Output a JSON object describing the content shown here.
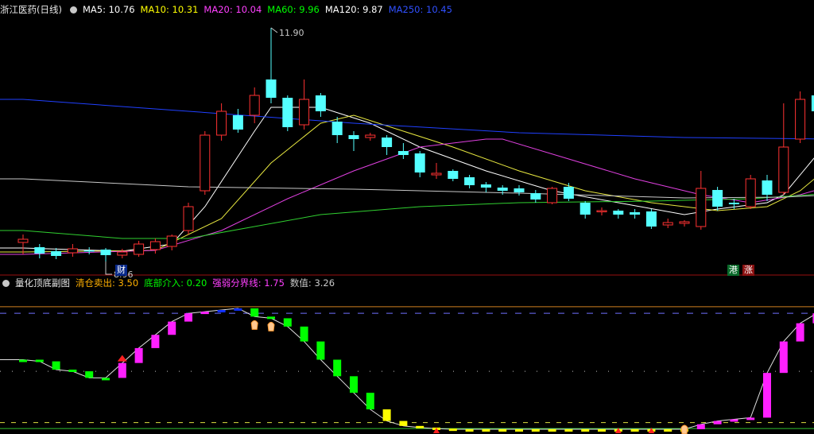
{
  "header": {
    "title": "浙江医药(日线)",
    "ma": [
      {
        "label": "MA5: 10.76",
        "color": "#ffffff"
      },
      {
        "label": "MA10: 10.31",
        "color": "#ffff00"
      },
      {
        "label": "MA20: 10.04",
        "color": "#ff40ff"
      },
      {
        "label": "MA60: 9.96",
        "color": "#00ff00"
      },
      {
        "label": "MA120: 9.87",
        "color": "#ffffff"
      },
      {
        "label": "MA250: 10.45",
        "color": "#3050ff"
      }
    ]
  },
  "sub_header": {
    "title": "量化顶底副图",
    "items": [
      {
        "label": "清仓卖出: 3.50",
        "color": "#ffb000"
      },
      {
        "label": "底部介入: 0.20",
        "color": "#00ff00"
      },
      {
        "label": "强弱分界线: 1.75",
        "color": "#ff40ff"
      },
      {
        "label": "数值: 3.26",
        "color": "#c8c8c8"
      }
    ]
  },
  "tags": {
    "cai": "财",
    "gang": "港",
    "zhang": "涨"
  },
  "chart_data": [
    {
      "type": "candlestick",
      "price_range": [
        8.85,
        12.05
      ],
      "annotations": {
        "high_label": "11.90",
        "low_label": "8.96"
      },
      "candles": [
        [
          9.2,
          9.24,
          9.05,
          9.3
        ],
        [
          9.14,
          9.06,
          9.0,
          9.18
        ],
        [
          9.09,
          9.03,
          8.99,
          9.13
        ],
        [
          9.07,
          9.12,
          9.02,
          9.18
        ],
        [
          9.1,
          9.09,
          9.05,
          9.14
        ],
        [
          9.11,
          9.04,
          8.96,
          9.13
        ],
        [
          9.04,
          9.08,
          9.0,
          9.12
        ],
        [
          9.05,
          9.18,
          9.02,
          9.22
        ],
        [
          9.11,
          9.21,
          9.06,
          9.25
        ],
        [
          9.15,
          9.28,
          9.1,
          9.3
        ],
        [
          9.35,
          9.65,
          9.3,
          9.7
        ],
        [
          9.85,
          10.55,
          9.8,
          10.6
        ],
        [
          10.55,
          10.85,
          10.48,
          10.95
        ],
        [
          10.8,
          10.62,
          10.58,
          10.88
        ],
        [
          10.8,
          11.05,
          10.7,
          11.15
        ],
        [
          11.25,
          11.02,
          10.95,
          11.9
        ],
        [
          11.02,
          10.65,
          10.6,
          11.05
        ],
        [
          10.68,
          11.0,
          10.62,
          11.25
        ],
        [
          11.05,
          10.85,
          10.78,
          11.08
        ],
        [
          10.72,
          10.55,
          10.45,
          10.78
        ],
        [
          10.55,
          10.5,
          10.35,
          10.6
        ],
        [
          10.52,
          10.55,
          10.48,
          10.58
        ],
        [
          10.52,
          10.4,
          10.3,
          10.55
        ],
        [
          10.35,
          10.3,
          10.25,
          10.45
        ],
        [
          10.32,
          10.08,
          10.02,
          10.35
        ],
        [
          10.05,
          10.07,
          10.0,
          10.2
        ],
        [
          10.1,
          10.0,
          9.97,
          10.12
        ],
        [
          10.02,
          9.92,
          9.88,
          10.05
        ],
        [
          9.93,
          9.89,
          9.83,
          9.96
        ],
        [
          9.89,
          9.85,
          9.8,
          9.92
        ],
        [
          9.88,
          9.83,
          9.79,
          9.92
        ],
        [
          9.82,
          9.74,
          9.7,
          9.86
        ],
        [
          9.7,
          9.88,
          9.68,
          9.9
        ],
        [
          9.9,
          9.75,
          9.72,
          9.95
        ],
        [
          9.7,
          9.55,
          9.5,
          9.72
        ],
        [
          9.59,
          9.6,
          9.54,
          9.64
        ],
        [
          9.6,
          9.55,
          9.5,
          9.62
        ],
        [
          9.58,
          9.55,
          9.5,
          9.62
        ],
        [
          9.59,
          9.4,
          9.37,
          9.62
        ],
        [
          9.42,
          9.45,
          9.38,
          9.5
        ],
        [
          9.44,
          9.46,
          9.4,
          9.48
        ],
        [
          9.4,
          9.88,
          9.36,
          10.1
        ],
        [
          9.86,
          9.65,
          9.6,
          9.9
        ],
        [
          9.7,
          9.68,
          9.62,
          9.75
        ],
        [
          9.65,
          10.0,
          9.62,
          10.05
        ],
        [
          9.98,
          9.8,
          9.72,
          10.05
        ],
        [
          9.83,
          10.4,
          9.8,
          10.95
        ],
        [
          10.5,
          11.0,
          10.45,
          11.1
        ],
        [
          11.05,
          10.85,
          10.8,
          11.15
        ],
        [
          10.8,
          11.05,
          10.75,
          11.35
        ]
      ],
      "ma_series": [
        {
          "name": "MA5",
          "color": "#ffffff",
          "points": [
            [
              0,
              9.13
            ],
            [
              6,
              9.09
            ],
            [
              9,
              9.18
            ],
            [
              11,
              9.65
            ],
            [
              14,
              10.6
            ],
            [
              15,
              10.9
            ],
            [
              18,
              10.9
            ],
            [
              21,
              10.7
            ],
            [
              24,
              10.4
            ],
            [
              28,
              10.1
            ],
            [
              32,
              9.85
            ],
            [
              36,
              9.7
            ],
            [
              40,
              9.55
            ],
            [
              42,
              9.62
            ],
            [
              45,
              9.7
            ],
            [
              46,
              9.8
            ],
            [
              48,
              10.3
            ],
            [
              49,
              10.55
            ]
          ]
        },
        {
          "name": "MA10",
          "color": "#e8e840",
          "points": [
            [
              0,
              9.08
            ],
            [
              8,
              9.1
            ],
            [
              12,
              9.5
            ],
            [
              15,
              10.2
            ],
            [
              18,
              10.7
            ],
            [
              20,
              10.8
            ],
            [
              23,
              10.6
            ],
            [
              26,
              10.4
            ],
            [
              30,
              10.1
            ],
            [
              34,
              9.85
            ],
            [
              38,
              9.7
            ],
            [
              42,
              9.6
            ],
            [
              45,
              9.65
            ],
            [
              47,
              9.85
            ],
            [
              49,
              10.2
            ]
          ]
        },
        {
          "name": "MA20",
          "color": "#e040e0",
          "points": [
            [
              0,
              9.05
            ],
            [
              8,
              9.1
            ],
            [
              12,
              9.35
            ],
            [
              16,
              9.75
            ],
            [
              20,
              10.1
            ],
            [
              24,
              10.4
            ],
            [
              28,
              10.5
            ],
            [
              29,
              10.5
            ],
            [
              33,
              10.25
            ],
            [
              37,
              10.0
            ],
            [
              41,
              9.8
            ],
            [
              44,
              9.7
            ],
            [
              47,
              9.8
            ],
            [
              49,
              9.92
            ]
          ]
        },
        {
          "name": "MA60",
          "color": "#30d030",
          "points": [
            [
              0,
              9.35
            ],
            [
              6,
              9.25
            ],
            [
              10,
              9.25
            ],
            [
              14,
              9.4
            ],
            [
              18,
              9.55
            ],
            [
              24,
              9.65
            ],
            [
              30,
              9.7
            ],
            [
              38,
              9.72
            ],
            [
              44,
              9.75
            ],
            [
              49,
              9.82
            ]
          ]
        },
        {
          "name": "MA120",
          "color": "#c8c8c8",
          "points": [
            [
              0,
              10.0
            ],
            [
              10,
              9.9
            ],
            [
              20,
              9.87
            ],
            [
              30,
              9.82
            ],
            [
              40,
              9.76
            ],
            [
              46,
              9.77
            ],
            [
              49,
              9.8
            ]
          ]
        },
        {
          "name": "MA250",
          "color": "#2040ff",
          "points": [
            [
              0,
              11.0
            ],
            [
              10,
              10.85
            ],
            [
              20,
              10.7
            ],
            [
              30,
              10.58
            ],
            [
              40,
              10.52
            ],
            [
              49,
              10.5
            ]
          ]
        }
      ]
    },
    {
      "type": "bar",
      "y_range": [
        0,
        4.2
      ],
      "levels": {
        "清仓卖出": 3.5,
        "底部介入": 0.2,
        "强弱分界线": 1.75,
        "top": 3.7
      },
      "values": [
        2.1,
        2.05,
        1.8,
        1.75,
        1.55,
        1.55,
        2.0,
        2.45,
        2.85,
        3.25,
        3.5,
        3.55,
        3.6,
        3.65,
        3.4,
        3.35,
        3.1,
        2.65,
        2.1,
        1.6,
        1.1,
        0.6,
        0.25,
        0.1,
        0.05,
        0.02,
        0.0,
        0.0,
        0.0,
        0.0,
        0.0,
        0.0,
        0.0,
        0.0,
        0.0,
        0.0,
        0.0,
        0.0,
        0.0,
        0.0,
        0.0,
        0.15,
        0.25,
        0.3,
        0.35,
        1.7,
        2.65,
        3.2,
        3.5,
        3.48
      ],
      "colors": [
        "g",
        "g",
        "g",
        "g",
        "g",
        "g",
        "m",
        "m",
        "m",
        "m",
        "m",
        "m",
        "b",
        "b",
        "g",
        "g",
        "g",
        "g",
        "g",
        "g",
        "g",
        "g",
        "y",
        "y",
        "y",
        "y",
        "y",
        "y",
        "y",
        "y",
        "y",
        "y",
        "y",
        "y",
        "y",
        "y",
        "y",
        "y",
        "y",
        "y",
        "y",
        "m",
        "m",
        "m",
        "m",
        "m",
        "m",
        "m",
        "m",
        "m"
      ],
      "signals": [
        {
          "type": "buy-arrow",
          "index": 6
        },
        {
          "type": "sell-hand",
          "index": 14
        },
        {
          "type": "sell-hand",
          "index": 15
        },
        {
          "type": "buy-hand",
          "index": 40
        },
        {
          "type": "bottom-arrow",
          "index": 25
        },
        {
          "type": "bottom-arrow",
          "index": 36
        },
        {
          "type": "bottom-arrow",
          "index": 38
        }
      ]
    }
  ]
}
